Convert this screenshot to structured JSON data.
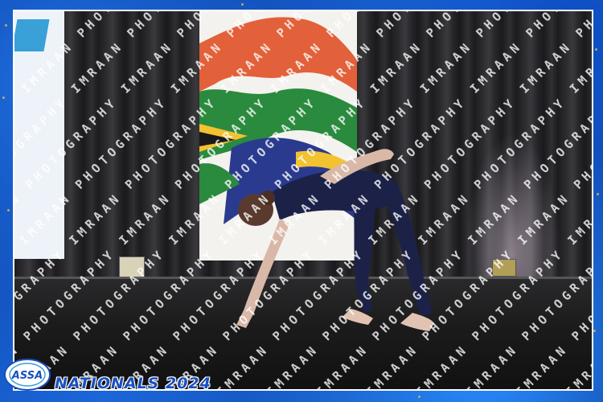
{
  "watermark": {
    "text": "IMRAAN PHOTOGRAPHY"
  },
  "branding": {
    "logo_text": "ASSA",
    "event_title": "NATIONALS 2024"
  },
  "colors": {
    "frame_blue": "#1b66d9",
    "flag_red": "#e2603a",
    "flag_green": "#2a8a3e",
    "flag_navy": "#2a3b8f",
    "flag_gold": "#f2c230",
    "costume_navy": "#1c2148"
  },
  "icons": {
    "logo": "assa-logo-icon"
  }
}
